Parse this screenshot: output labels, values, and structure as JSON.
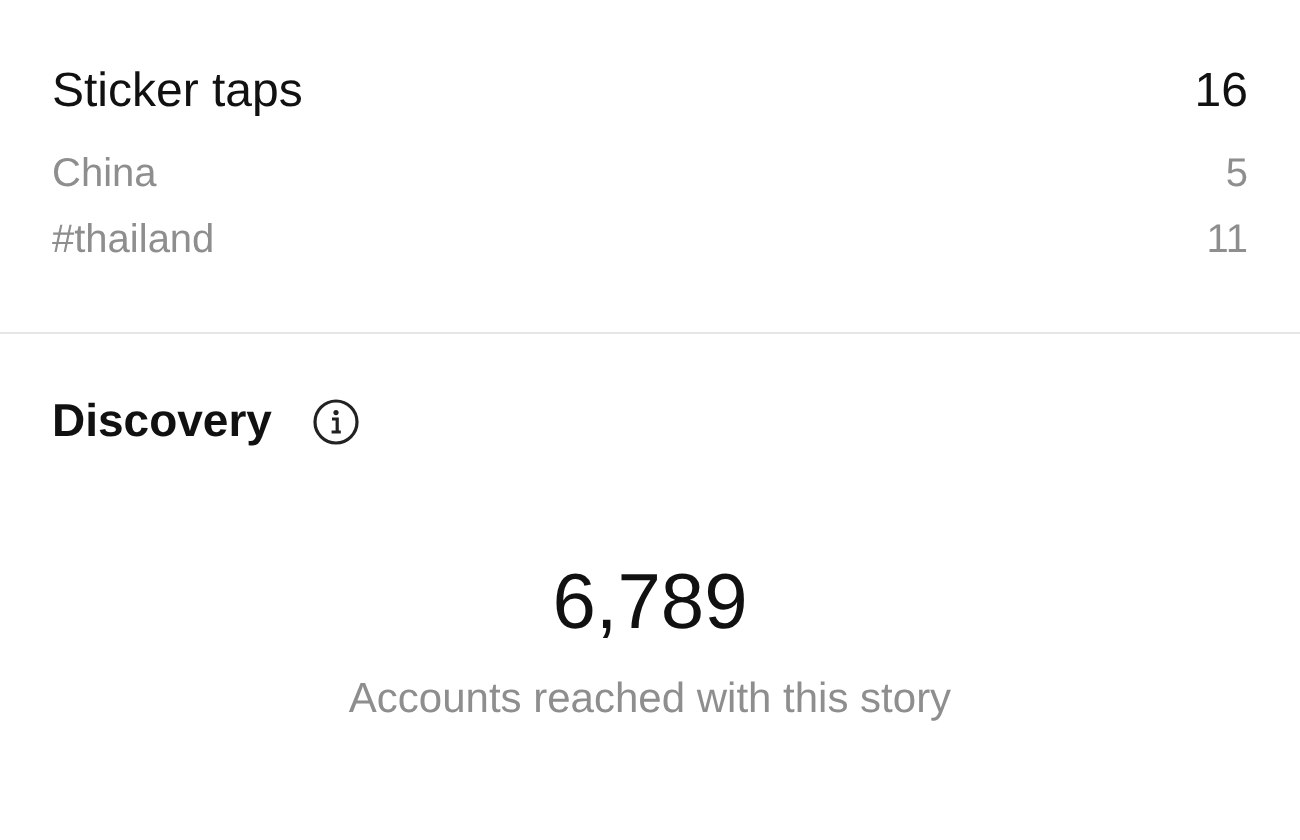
{
  "sticker_taps": {
    "label": "Sticker taps",
    "value": "16",
    "rows": [
      {
        "label": "China",
        "value": "5"
      },
      {
        "label": "#thailand",
        "value": "11"
      }
    ]
  },
  "discovery": {
    "title": "Discovery",
    "metric": {
      "value": "6,789",
      "caption": "Accounts reached with this story"
    }
  }
}
